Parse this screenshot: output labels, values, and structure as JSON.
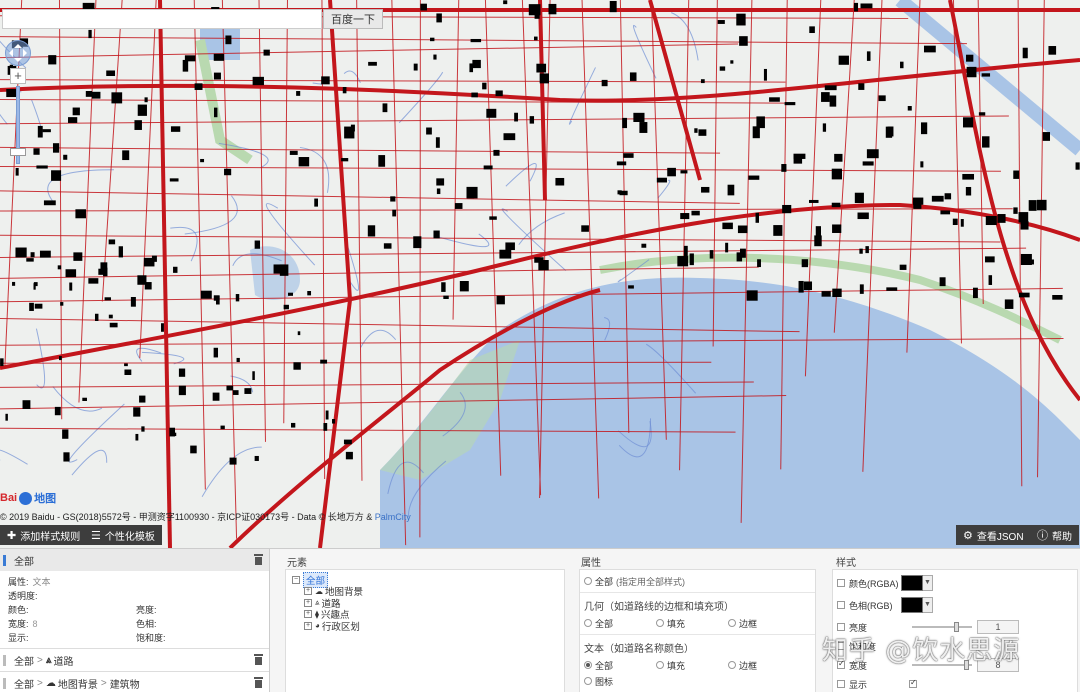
{
  "search": {
    "placeholder": "",
    "button_label": "百度一下"
  },
  "map": {
    "zoom_control": {
      "plus": "+"
    },
    "logo": {
      "text": "Bai",
      "suffix": "地图"
    },
    "copyright": "© 2019 Baidu - GS(2018)5572号 - 甲测资字1100930 - 京ICP证030173号 - Data © 长地万方 & ",
    "copyright_link": "PalmCity",
    "colors": {
      "road": "#c3161c",
      "water": "#a9c4e6",
      "minor_road": "#6f8fd4",
      "building": "#000000",
      "green": "#b9d9b0",
      "land": "#eef0ee"
    }
  },
  "toolbar": {
    "add_rule": "添加样式规则",
    "templates": "个性化模板",
    "view_json": "查看JSON",
    "help": "帮助"
  },
  "rules": [
    {
      "label": "全部",
      "properties": [
        {
          "name": "属性:",
          "value": "文本",
          "full": true
        },
        {
          "name": "透明度:",
          "value": "",
          "full": true
        },
        {
          "name": "颜色:",
          "value": ""
        },
        {
          "name": "亮度:",
          "value": ""
        },
        {
          "name": "宽度:",
          "value": "8"
        },
        {
          "name": "色相:",
          "value": ""
        },
        {
          "name": "显示:",
          "value": ""
        },
        {
          "name": "饱和度:",
          "value": ""
        }
      ]
    },
    {
      "path": [
        "全部",
        "道路"
      ]
    },
    {
      "path": [
        "全部",
        "地图背景",
        "建筑物"
      ]
    }
  ],
  "elements": {
    "title": "元素",
    "root": "全部",
    "children": [
      "地图背景",
      "道路",
      "兴趣点",
      "行政区划"
    ]
  },
  "attributes": {
    "title": "属性",
    "all_option": "全部",
    "all_hint": "(指定用全部样式)",
    "geometry_label": "几何（如道路线的边框和填充项）",
    "text_label": "文本（如道路名称颜色）",
    "geometry_options": [
      "全部",
      "填充",
      "边框"
    ],
    "text_options": [
      "全部",
      "填充",
      "边框"
    ],
    "icon_option": "图标"
  },
  "style": {
    "title": "样式",
    "color_rgba": "颜色(RGBA)",
    "hue_rgb": "色相(RGB)",
    "brightness": "亮度",
    "brightness_value": "1",
    "saturation": "饱和度",
    "width": "宽度",
    "width_value": "8",
    "visible": "显示",
    "color_value": "#000000"
  },
  "watermark": "知乎 @饮水思源"
}
